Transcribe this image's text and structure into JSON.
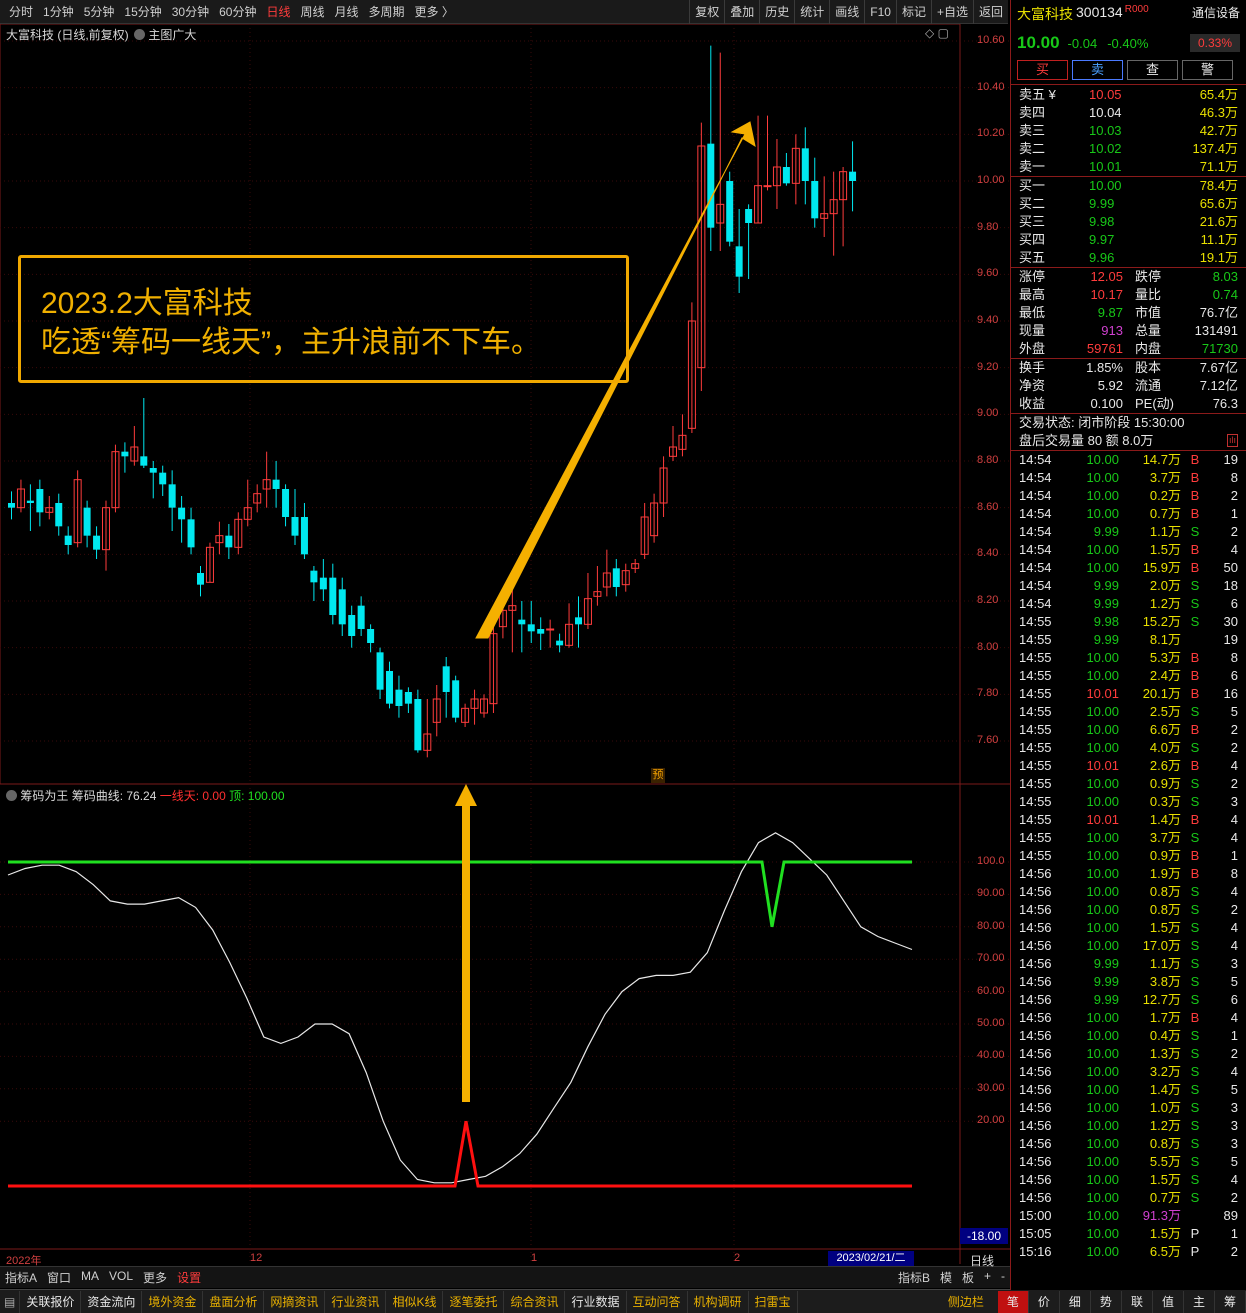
{
  "toolbar": {
    "periods": [
      "分时",
      "1分钟",
      "5分钟",
      "15分钟",
      "30分钟",
      "60分钟",
      "日线",
      "周线",
      "月线",
      "多周期",
      "更多 〉"
    ],
    "active": "日线",
    "right": [
      "复权",
      "叠加",
      "历史",
      "统计",
      "画线",
      "F10",
      "标记",
      "+自选",
      "返回"
    ]
  },
  "chart_header": {
    "title": "大富科技 (日线,前复权)",
    "subtitle": "主图广大"
  },
  "annotation": {
    "line1": "2023.2大富科技",
    "line2": "吃透“筹码一线天”，主升浪前不下车。"
  },
  "main_axis": {
    "labels": [
      "10.60",
      "10.40",
      "10.20",
      "10.00",
      "9.80",
      "9.60",
      "9.40",
      "9.20",
      "9.00",
      "8.80",
      "8.60",
      "8.40",
      "8.20",
      "8.00",
      "7.80",
      "7.60"
    ]
  },
  "pre_marker": "预",
  "indicator": {
    "name": "筹码为王",
    "curve_label": "筹码曲线: 76.24",
    "red_label": "一线天: 0.00",
    "green_label": "顶: 100.00",
    "axis": [
      "100.0",
      "90.00",
      "80.00",
      "70.00",
      "60.00",
      "50.00",
      "40.00",
      "30.00",
      "20.00"
    ],
    "bottom_value": "-18.00"
  },
  "date_axis": {
    "labels": [
      "2022年",
      "12",
      "1",
      "2"
    ],
    "current": "2023/02/21/二"
  },
  "stock": {
    "name": "大富科技",
    "code": "300134",
    "badge": "R",
    "price": "10.00",
    "change": "-0.04",
    "pct": "-0.40%",
    "device": "通信设备",
    "device_pct": "0.33%"
  },
  "trade_buttons": [
    "买",
    "卖",
    "查",
    "警"
  ],
  "asks": [
    [
      "卖五 ¥",
      "10.05",
      "65.4万"
    ],
    [
      "卖四",
      "10.04",
      "46.3万"
    ],
    [
      "卖三",
      "10.03",
      "42.7万"
    ],
    [
      "卖二",
      "10.02",
      "137.4万"
    ],
    [
      "卖一",
      "10.01",
      "71.1万"
    ]
  ],
  "bids": [
    [
      "买一",
      "10.00",
      "78.4万"
    ],
    [
      "买二",
      "9.99",
      "65.6万"
    ],
    [
      "买三",
      "9.98",
      "21.6万"
    ],
    [
      "买四",
      "9.97",
      "11.1万"
    ],
    [
      "买五",
      "9.96",
      "19.1万"
    ]
  ],
  "stats": [
    [
      "涨停",
      "12.05",
      "跌停",
      "8.03"
    ],
    [
      "最高",
      "10.17",
      "量比",
      "0.74"
    ],
    [
      "最低",
      "9.87",
      "市值",
      "76.7亿"
    ],
    [
      "现量",
      "913",
      "总量",
      "131491"
    ],
    [
      "外盘",
      "59761",
      "内盘",
      "71730"
    ]
  ],
  "stats2": [
    [
      "换手",
      "1.85%",
      "股本",
      "7.67亿"
    ],
    [
      "净资",
      "5.92",
      "流通",
      "7.12亿"
    ],
    [
      "收益",
      "0.100",
      "PE(动)",
      "76.3"
    ]
  ],
  "status": "交易状态: 闭市阶段 15:30:00",
  "after_hours": "盘后交易量 80 额 8.0万",
  "ticks": [
    [
      "14:54",
      "10.00",
      "14.7万",
      "B",
      "19"
    ],
    [
      "14:54",
      "10.00",
      "3.7万",
      "B",
      "8"
    ],
    [
      "14:54",
      "10.00",
      "0.2万",
      "B",
      "2"
    ],
    [
      "14:54",
      "10.00",
      "0.7万",
      "B",
      "1"
    ],
    [
      "14:54",
      "9.99",
      "1.1万",
      "S",
      "2"
    ],
    [
      "14:54",
      "10.00",
      "1.5万",
      "B",
      "4"
    ],
    [
      "14:54",
      "10.00",
      "15.9万",
      "B",
      "50"
    ],
    [
      "14:54",
      "9.99",
      "2.0万",
      "S",
      "18"
    ],
    [
      "14:54",
      "9.99",
      "1.2万",
      "S",
      "6"
    ],
    [
      "14:55",
      "9.98",
      "15.2万",
      "S",
      "30"
    ],
    [
      "14:55",
      "9.99",
      "8.1万",
      "",
      "19"
    ],
    [
      "14:55",
      "10.00",
      "5.3万",
      "B",
      "8"
    ],
    [
      "14:55",
      "10.00",
      "2.4万",
      "B",
      "6"
    ],
    [
      "14:55",
      "10.01",
      "20.1万",
      "B",
      "16"
    ],
    [
      "14:55",
      "10.00",
      "2.5万",
      "S",
      "5"
    ],
    [
      "14:55",
      "10.00",
      "6.6万",
      "B",
      "2"
    ],
    [
      "14:55",
      "10.00",
      "4.0万",
      "S",
      "2"
    ],
    [
      "14:55",
      "10.01",
      "2.6万",
      "B",
      "4"
    ],
    [
      "14:55",
      "10.00",
      "0.9万",
      "S",
      "2"
    ],
    [
      "14:55",
      "10.00",
      "0.3万",
      "S",
      "3"
    ],
    [
      "14:55",
      "10.01",
      "1.4万",
      "B",
      "4"
    ],
    [
      "14:55",
      "10.00",
      "3.7万",
      "S",
      "4"
    ],
    [
      "14:55",
      "10.00",
      "0.9万",
      "B",
      "1"
    ],
    [
      "14:56",
      "10.00",
      "1.9万",
      "B",
      "8"
    ],
    [
      "14:56",
      "10.00",
      "0.8万",
      "S",
      "4"
    ],
    [
      "14:56",
      "10.00",
      "0.8万",
      "S",
      "2"
    ],
    [
      "14:56",
      "10.00",
      "1.5万",
      "S",
      "4"
    ],
    [
      "14:56",
      "10.00",
      "17.0万",
      "S",
      "4"
    ],
    [
      "14:56",
      "9.99",
      "1.1万",
      "S",
      "3"
    ],
    [
      "14:56",
      "9.99",
      "3.8万",
      "S",
      "5"
    ],
    [
      "14:56",
      "9.99",
      "12.7万",
      "S",
      "6"
    ],
    [
      "14:56",
      "10.00",
      "1.7万",
      "B",
      "4"
    ],
    [
      "14:56",
      "10.00",
      "0.4万",
      "S",
      "1"
    ],
    [
      "14:56",
      "10.00",
      "1.3万",
      "S",
      "2"
    ],
    [
      "14:56",
      "10.00",
      "3.2万",
      "S",
      "4"
    ],
    [
      "14:56",
      "10.00",
      "1.4万",
      "S",
      "5"
    ],
    [
      "14:56",
      "10.00",
      "1.0万",
      "S",
      "3"
    ],
    [
      "14:56",
      "10.00",
      "1.2万",
      "S",
      "3"
    ],
    [
      "14:56",
      "10.00",
      "0.8万",
      "S",
      "3"
    ],
    [
      "14:56",
      "10.00",
      "5.5万",
      "S",
      "5"
    ],
    [
      "14:56",
      "10.00",
      "1.5万",
      "S",
      "4"
    ],
    [
      "14:56",
      "10.00",
      "0.7万",
      "S",
      "2"
    ],
    [
      "15:00",
      "10.00",
      "91.3万",
      "",
      "89"
    ],
    [
      "15:05",
      "10.00",
      "1.5万",
      "P",
      "1"
    ],
    [
      "15:16",
      "10.00",
      "6.5万",
      "P",
      "2"
    ]
  ],
  "bottom_tabs": [
    "指标A",
    "窗口",
    "MA",
    "VOL",
    "更多",
    "设置"
  ],
  "bottom_right": [
    "指标B",
    "模",
    "板",
    "+",
    "-"
  ],
  "bottom_right_extra": "日线",
  "footer": [
    "关联报价",
    "资金流向",
    "境外资金",
    "盘面分析",
    "网摘资讯",
    "行业资讯",
    "相似K线",
    "逐笔委托",
    "综合资讯",
    "行业数据",
    "互动问答",
    "机构调研",
    "扫雷宝"
  ],
  "footer_right": "侧边栏",
  "footer_tabs": [
    "笔",
    "价",
    "细",
    "势",
    "联",
    "值",
    "主",
    "筹"
  ],
  "chart_data": {
    "type": "candlestick",
    "candles": [
      [
        8.62,
        8.6,
        8.67,
        8.55
      ],
      [
        8.6,
        8.68,
        8.72,
        8.58
      ],
      [
        8.63,
        8.62,
        8.7,
        8.5
      ],
      [
        8.68,
        8.58,
        8.72,
        8.52
      ],
      [
        8.58,
        8.6,
        8.65,
        8.55
      ],
      [
        8.62,
        8.52,
        8.66,
        8.48
      ],
      [
        8.48,
        8.44,
        8.52,
        8.4
      ],
      [
        8.45,
        8.72,
        8.76,
        8.43
      ],
      [
        8.6,
        8.48,
        8.63,
        8.43
      ],
      [
        8.48,
        8.42,
        8.52,
        8.38
      ],
      [
        8.42,
        8.6,
        8.63,
        8.33
      ],
      [
        8.6,
        8.84,
        8.87,
        8.58
      ],
      [
        8.84,
        8.82,
        8.88,
        8.75
      ],
      [
        8.8,
        8.86,
        8.95,
        8.78
      ],
      [
        8.82,
        8.78,
        9.07,
        8.77
      ],
      [
        8.77,
        8.75,
        8.8,
        8.64
      ],
      [
        8.75,
        8.7,
        8.78,
        8.65
      ],
      [
        8.7,
        8.6,
        8.76,
        8.5
      ],
      [
        8.6,
        8.55,
        8.65,
        8.45
      ],
      [
        8.55,
        8.43,
        8.6,
        8.4
      ],
      [
        8.32,
        8.27,
        8.35,
        8.22
      ],
      [
        8.28,
        8.43,
        8.45,
        8.28
      ],
      [
        8.45,
        8.48,
        8.54,
        8.4
      ],
      [
        8.48,
        8.43,
        8.53,
        8.38
      ],
      [
        8.43,
        8.55,
        8.58,
        8.4
      ],
      [
        8.55,
        8.6,
        8.72,
        8.52
      ],
      [
        8.62,
        8.66,
        8.7,
        8.58
      ],
      [
        8.68,
        8.72,
        8.84,
        8.6
      ],
      [
        8.72,
        8.68,
        8.8,
        8.6
      ],
      [
        8.68,
        8.56,
        8.7,
        8.52
      ],
      [
        8.56,
        8.48,
        8.68,
        8.44
      ],
      [
        8.56,
        8.4,
        8.62,
        8.38
      ],
      [
        8.33,
        8.28,
        8.35,
        8.2
      ],
      [
        8.3,
        8.25,
        8.38,
        8.2
      ],
      [
        8.3,
        8.14,
        8.36,
        8.1
      ],
      [
        8.25,
        8.1,
        8.3,
        8.05
      ],
      [
        8.14,
        8.05,
        8.18,
        8.0
      ],
      [
        8.18,
        8.08,
        8.22,
        8.05
      ],
      [
        8.08,
        8.02,
        8.1,
        7.98
      ],
      [
        7.98,
        7.82,
        8.0,
        7.78
      ],
      [
        7.9,
        7.76,
        7.94,
        7.74
      ],
      [
        7.82,
        7.75,
        7.88,
        7.7
      ],
      [
        7.81,
        7.76,
        7.83,
        7.72
      ],
      [
        7.78,
        7.56,
        7.82,
        7.55
      ],
      [
        7.56,
        7.63,
        7.78,
        7.53
      ],
      [
        7.68,
        7.78,
        7.84,
        7.62
      ],
      [
        7.92,
        7.81,
        7.96,
        7.7
      ],
      [
        7.86,
        7.7,
        7.88,
        7.68
      ],
      [
        7.68,
        7.74,
        7.76,
        7.66
      ],
      [
        7.74,
        7.78,
        7.82,
        7.67
      ],
      [
        7.72,
        7.78,
        7.8,
        7.7
      ],
      [
        7.76,
        8.06,
        8.1,
        7.72
      ],
      [
        8.09,
        8.16,
        8.24,
        8.04
      ],
      [
        8.16,
        8.18,
        8.26,
        7.98
      ],
      [
        8.12,
        8.1,
        8.2,
        7.98
      ],
      [
        8.1,
        8.07,
        8.2,
        8.02
      ],
      [
        8.08,
        8.06,
        8.13,
        7.99
      ],
      [
        8.08,
        8.08,
        8.12,
        8.0
      ],
      [
        8.03,
        8.01,
        8.06,
        7.98
      ],
      [
        8.01,
        8.1,
        8.19,
        8.0
      ],
      [
        8.13,
        8.1,
        8.22,
        8.0
      ],
      [
        8.1,
        8.21,
        8.32,
        8.08
      ],
      [
        8.22,
        8.24,
        8.35,
        8.18
      ],
      [
        8.26,
        8.32,
        8.42,
        8.22
      ],
      [
        8.34,
        8.26,
        8.38,
        8.22
      ],
      [
        8.27,
        8.33,
        8.36,
        8.24
      ],
      [
        8.34,
        8.36,
        8.38,
        8.32
      ],
      [
        8.4,
        8.56,
        8.62,
        8.38
      ],
      [
        8.48,
        8.62,
        8.66,
        8.45
      ],
      [
        8.62,
        8.77,
        8.82,
        8.56
      ],
      [
        8.82,
        8.86,
        8.95,
        8.8
      ],
      [
        8.85,
        8.91,
        9.0,
        8.82
      ],
      [
        8.94,
        9.4,
        9.48,
        8.92
      ],
      [
        9.2,
        10.15,
        10.25,
        9.1
      ],
      [
        10.16,
        9.8,
        10.58,
        9.7
      ],
      [
        9.82,
        9.9,
        10.55,
        9.7
      ],
      [
        10.0,
        9.74,
        10.04,
        9.72
      ],
      [
        9.72,
        9.59,
        9.88,
        9.52
      ],
      [
        9.88,
        9.82,
        9.9,
        9.58
      ],
      [
        9.82,
        9.98,
        10.28,
        9.82
      ],
      [
        9.98,
        9.98,
        10.28,
        9.96
      ],
      [
        9.98,
        10.06,
        10.18,
        9.88
      ],
      [
        10.06,
        9.99,
        10.12,
        9.98
      ],
      [
        9.99,
        10.14,
        10.2,
        9.9
      ],
      [
        10.14,
        10.0,
        10.23,
        9.9
      ],
      [
        10.0,
        9.84,
        10.1,
        9.8
      ],
      [
        9.84,
        9.86,
        10.02,
        9.76
      ],
      [
        9.86,
        9.92,
        10.04,
        9.68
      ],
      [
        9.92,
        10.04,
        10.06,
        9.72
      ],
      [
        10.04,
        10.0,
        10.17,
        9.87
      ]
    ],
    "indicator_line": [
      96,
      98,
      99,
      99,
      97,
      93,
      88,
      87,
      87,
      88,
      89,
      86,
      79,
      69,
      58,
      46,
      44,
      46,
      50,
      50,
      47,
      35,
      20,
      8,
      2,
      1,
      1,
      2,
      3,
      6,
      10,
      16,
      24,
      32,
      43,
      53,
      60,
      64,
      65,
      65,
      66,
      72,
      85,
      97,
      106,
      109,
      106,
      101,
      96,
      88,
      80,
      77,
      75,
      73
    ],
    "top_line": 100,
    "bottom_line": 0
  }
}
